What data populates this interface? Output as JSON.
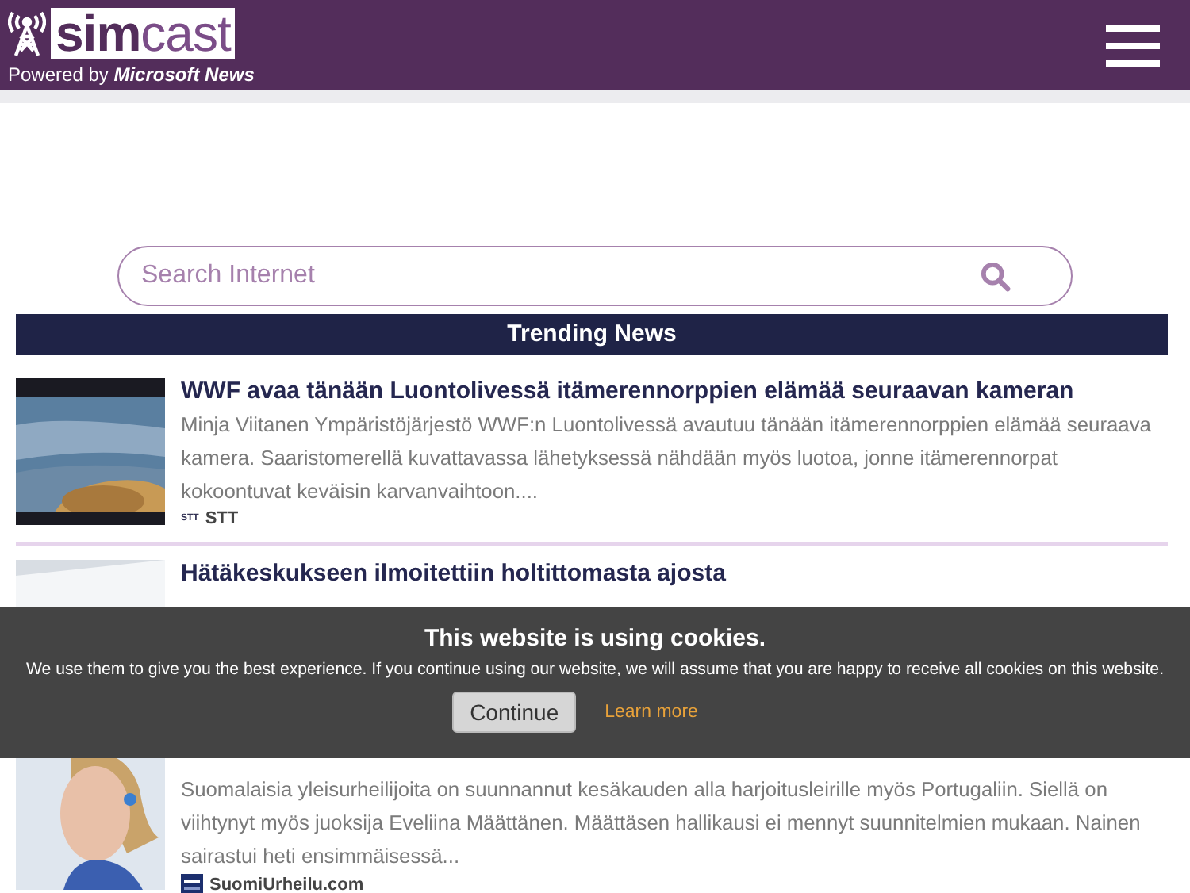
{
  "header": {
    "logo": {
      "prefix": "sim",
      "suffix": "cast"
    },
    "powered_by": "Powered by",
    "powered_brand": "Microsoft News"
  },
  "search": {
    "placeholder": "Search Internet"
  },
  "section_title": "Trending News",
  "articles": [
    {
      "title": "WWF avaa tänään Luontolivessä itämerennorppien elämää seuraavan kameran",
      "summary": "Minja Viitanen Ympäristöjärjestö WWF:n Luontolivessä avautuu tänään itämerennorppien elämää seuraava kamera. Saaristomerellä kuvattavassa lähetyksessä nähdään myös luotoa, jonne itämerennorpat kokoontuvat keväisin karvanvaihtoon....",
      "source": "STT",
      "source_logo": "STT"
    },
    {
      "title": "Hätäkeskukseen ilmoitettiin holtittomasta ajosta"
    },
    {
      "summary": "Suomalaisia yleisurheilijoita on suunnannut kesäkauden alla harjoitusleirille myös Portugaliin. Siellä on viihtynyt myös juoksija Eveliina Määttänen. Määttäsen hallikausi ei mennyt suunnitelmien mukaan. Nainen sairastui heti ensimmäisessä...",
      "source": "SuomiUrheilu.com"
    }
  ],
  "cookie_banner": {
    "title": "This website is using cookies.",
    "text": "We use them to give you the best experience. If you continue using our website, we will assume that you are happy to receive all cookies on this website.",
    "continue": "Continue",
    "learn_more": "Learn more"
  }
}
